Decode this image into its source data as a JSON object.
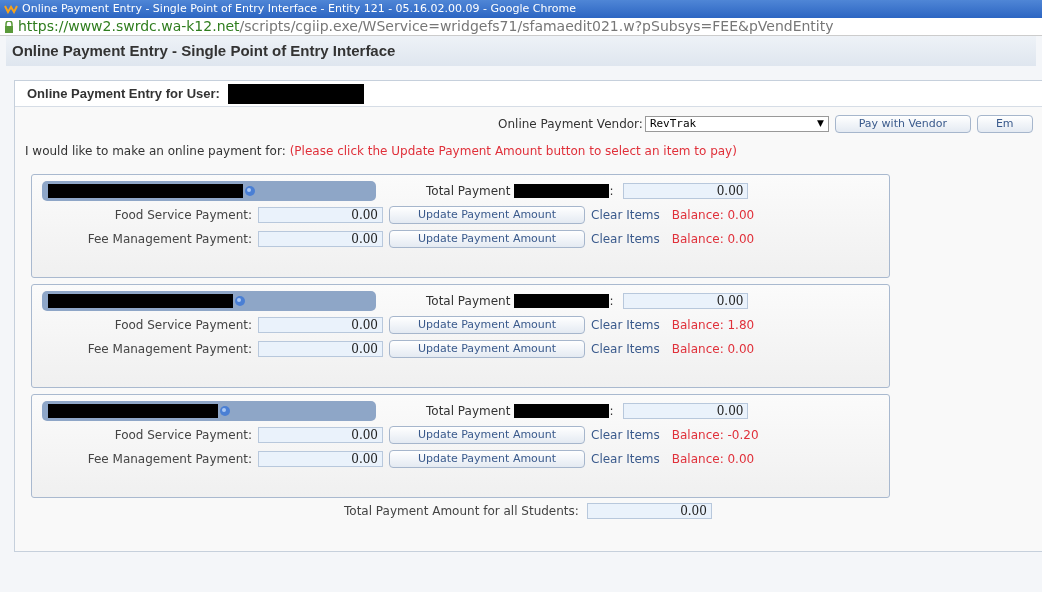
{
  "window": {
    "title": "Online Payment Entry - Single Point of Entry Interface - Entity 121 - 05.16.02.00.09 - Google Chrome"
  },
  "address_bar": {
    "secure": true,
    "host": "https://www2.swrdc.wa-k12.net",
    "path": "/scripts/cgiip.exe/WService=wridgefs71/sfamaedit021.w?pSubsys=FEE&pVendEntity"
  },
  "page_title": "Online Payment Entry - Single Point of Entry Interface",
  "user_label": "Online Payment Entry for User:",
  "vendor": {
    "label": "Online Payment Vendor:",
    "value": "RevTrak",
    "arrow": "▼",
    "buttons": [
      "Pay with Vendor",
      "Em"
    ]
  },
  "intro": "I would like to make an online payment for:",
  "notice": "(Please click the Update Payment Amount button to select an item to pay)",
  "students": [
    {
      "total_label": "Total Payment",
      "total_suffix": ":",
      "total": "0.00",
      "payments": [
        {
          "label": "Food Service Payment:",
          "amount": "0.00",
          "button": "Update Payment Amount",
          "clear": "Clear Items",
          "balance": "Balance: 0.00"
        },
        {
          "label": "Fee Management Payment:",
          "amount": "0.00",
          "button": "Update Payment Amount",
          "clear": "Clear Items",
          "balance": "Balance: 0.00"
        }
      ]
    },
    {
      "total_label": "Total Payment",
      "total_suffix": ":",
      "total": "0.00",
      "payments": [
        {
          "label": "Food Service Payment:",
          "amount": "0.00",
          "button": "Update Payment Amount",
          "clear": "Clear Items",
          "balance": "Balance: 1.80"
        },
        {
          "label": "Fee Management Payment:",
          "amount": "0.00",
          "button": "Update Payment Amount",
          "clear": "Clear Items",
          "balance": "Balance: 0.00"
        }
      ]
    },
    {
      "total_label": "Total Payment",
      "total_suffix": ":",
      "total": "0.00",
      "payments": [
        {
          "label": "Food Service Payment:",
          "amount": "0.00",
          "button": "Update Payment Amount",
          "clear": "Clear Items",
          "balance": "Balance: -0.20"
        },
        {
          "label": "Fee Management Payment:",
          "amount": "0.00",
          "button": "Update Payment Amount",
          "clear": "Clear Items",
          "balance": "Balance: 0.00"
        }
      ]
    }
  ],
  "grand_total": {
    "label": "Total Payment Amount for all Students:",
    "value": "0.00"
  }
}
